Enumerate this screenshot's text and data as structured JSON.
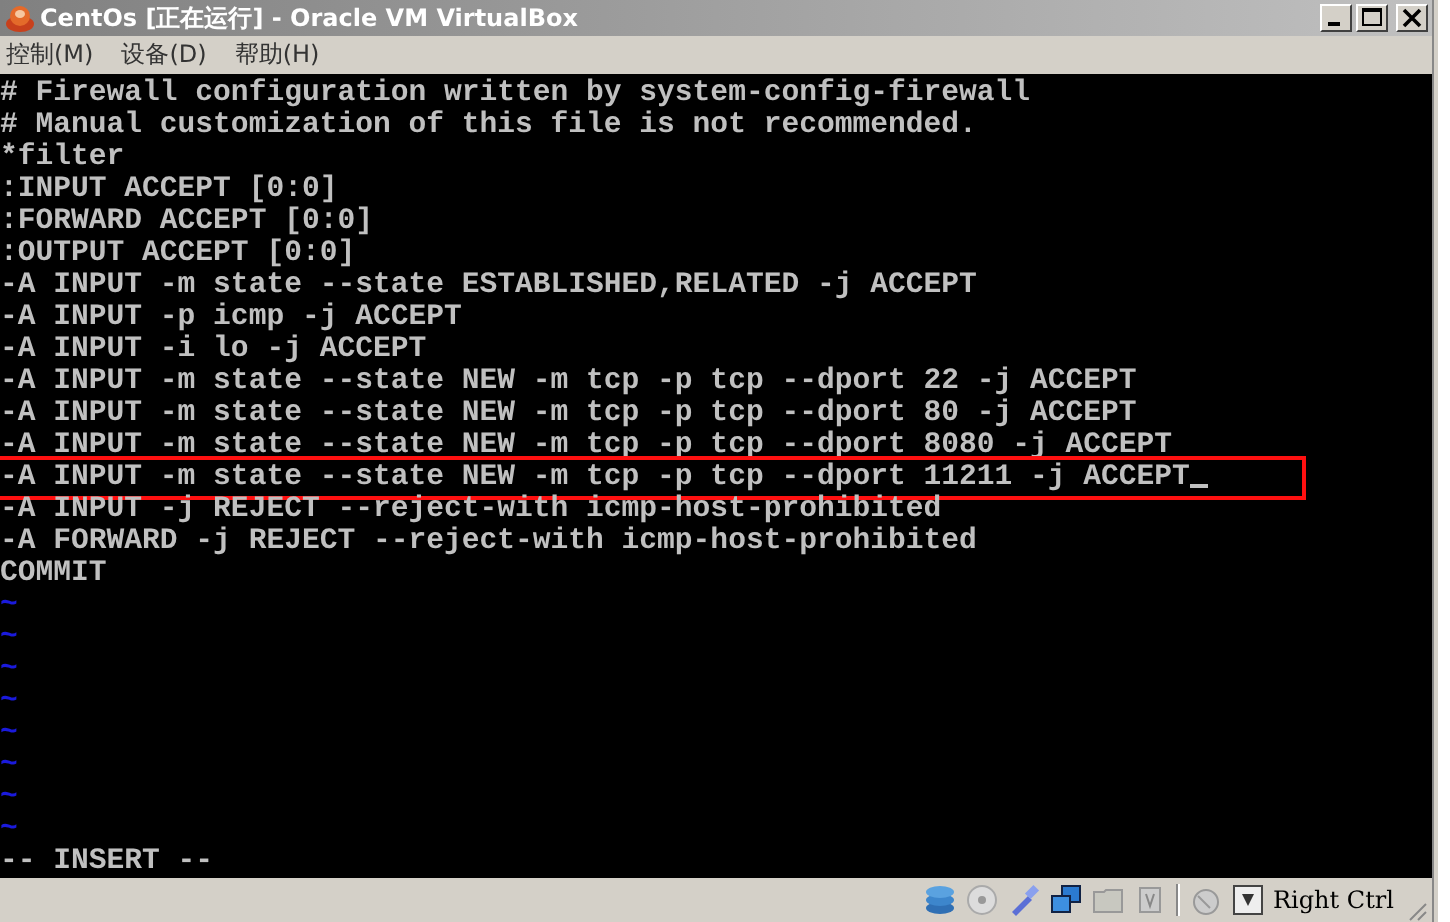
{
  "window": {
    "title": "CentOs [正在运行] - Oracle VM VirtualBox"
  },
  "menu": [
    "控制(M)",
    "设备(D)",
    "帮助(H)"
  ],
  "terminal": {
    "lines": [
      {
        "text": "# Firewall configuration written by system-config-firewall",
        "highlighted": false,
        "cursor": false
      },
      {
        "text": "# Manual customization of this file is not recommended.",
        "highlighted": false,
        "cursor": false
      },
      {
        "text": "*filter",
        "highlighted": false,
        "cursor": false
      },
      {
        "text": ":INPUT ACCEPT [0:0]",
        "highlighted": false,
        "cursor": false
      },
      {
        "text": ":FORWARD ACCEPT [0:0]",
        "highlighted": false,
        "cursor": false
      },
      {
        "text": ":OUTPUT ACCEPT [0:0]",
        "highlighted": false,
        "cursor": false
      },
      {
        "text": "-A INPUT -m state --state ESTABLISHED,RELATED -j ACCEPT",
        "highlighted": false,
        "cursor": false
      },
      {
        "text": "-A INPUT -p icmp -j ACCEPT",
        "highlighted": false,
        "cursor": false
      },
      {
        "text": "-A INPUT -i lo -j ACCEPT",
        "highlighted": false,
        "cursor": false
      },
      {
        "text": "-A INPUT -m state --state NEW -m tcp -p tcp --dport 22 -j ACCEPT",
        "highlighted": false,
        "cursor": false
      },
      {
        "text": "-A INPUT -m state --state NEW -m tcp -p tcp --dport 80 -j ACCEPT",
        "highlighted": false,
        "cursor": false
      },
      {
        "text": "-A INPUT -m state --state NEW -m tcp -p tcp --dport 8080 -j ACCEPT",
        "highlighted": false,
        "cursor": false
      },
      {
        "text": "-A INPUT -m state --state NEW -m tcp -p tcp --dport 11211 -j ACCEPT",
        "highlighted": true,
        "cursor": true
      },
      {
        "text": "-A INPUT -j REJECT --reject-with icmp-host-prohibited",
        "highlighted": false,
        "cursor": false
      },
      {
        "text": "-A FORWARD -j REJECT --reject-with icmp-host-prohibited",
        "highlighted": false,
        "cursor": false
      },
      {
        "text": "COMMIT",
        "highlighted": false,
        "cursor": false
      }
    ],
    "tildes": [
      "~",
      "~",
      "~",
      "~",
      "~",
      "~",
      "~",
      "~"
    ],
    "mode": "-- INSERT --"
  },
  "status_bar": {
    "host_key": "Right Ctrl"
  }
}
